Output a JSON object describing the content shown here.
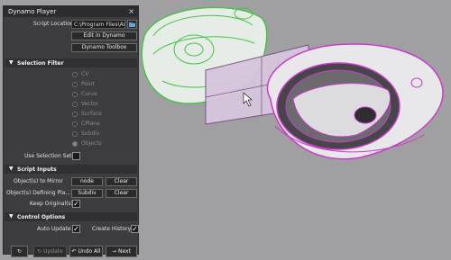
{
  "panel": {
    "title": "Dynamo Player",
    "close_icon": "×",
    "script_location_label": "Script Location",
    "script_location_value": "C:\\Program Files\\Au",
    "edit_button": "Edit in Dynamo",
    "toolbox_button": "Dynamo Toolbox"
  },
  "selection_filter": {
    "header": "Selection Filter",
    "options": [
      "CV",
      "Point",
      "Curve",
      "Vector",
      "Surface",
      "CPlane",
      "Subdiv",
      "Objects"
    ],
    "selected": "Objects",
    "use_selection_sets_label": "Use Selection Sets",
    "use_selection_sets_checked": false
  },
  "script_inputs": {
    "header": "Script Inputs",
    "mirror_label": "Object(s) to Mirror",
    "mirror_value": "node",
    "mirror_clear": "Clear",
    "plane_label": "Object(s) Defining Pla...",
    "plane_value": "Subdiv",
    "plane_clear": "Clear",
    "keep_label": "Keep Original(s)",
    "keep_checked": true
  },
  "control_options": {
    "header": "Control Options",
    "auto_update_label": "Auto Update",
    "auto_update_checked": true,
    "create_history_label": "Create History",
    "create_history_checked": true
  },
  "footer": {
    "update_label": "Update",
    "undo_all_label": "Undo All",
    "next_label": "Next"
  },
  "colors": {
    "viewport_bg": "#a1a1a3",
    "panel_bg": "#3d3d3f",
    "selection_magenta": "#c83cc8",
    "ghost_green": "#49c249"
  }
}
